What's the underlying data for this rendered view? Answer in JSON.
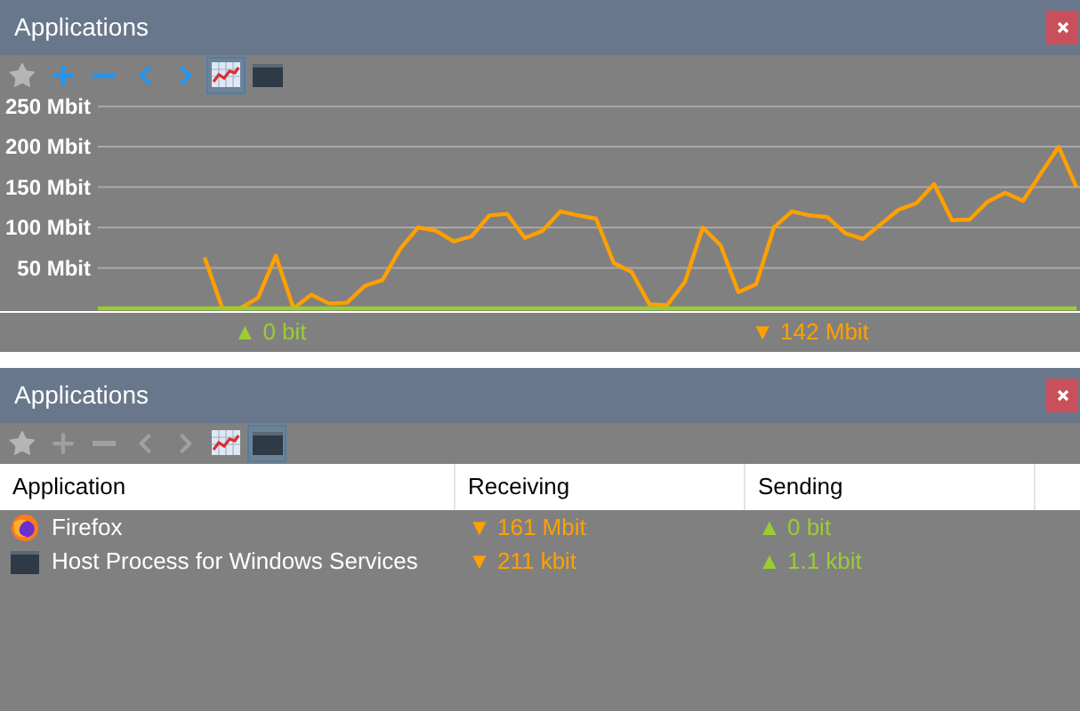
{
  "graph_panel": {
    "title": "Applications",
    "toolbar": [
      {
        "kind": "star",
        "disabled": true,
        "selected": false
      },
      {
        "kind": "add",
        "disabled": false,
        "selected": false
      },
      {
        "kind": "remove",
        "disabled": false,
        "selected": false
      },
      {
        "kind": "back",
        "disabled": false,
        "selected": false
      },
      {
        "kind": "forward",
        "disabled": false,
        "selected": false
      },
      {
        "kind": "graph",
        "selected": true
      },
      {
        "kind": "table",
        "selected": false
      }
    ],
    "chart_data": {
      "type": "line",
      "categories": [
        null,
        null,
        null,
        null,
        null,
        null,
        null,
        null,
        null,
        null,
        null,
        null,
        null,
        null,
        null,
        null,
        null,
        null,
        null,
        null,
        null,
        null,
        null,
        null,
        null,
        null,
        null,
        null,
        null,
        null,
        null,
        null,
        null,
        null,
        null,
        null,
        null,
        null,
        null,
        null,
        null,
        null,
        null,
        null,
        null,
        null,
        null,
        null,
        null,
        null,
        null,
        null,
        null,
        null,
        null,
        null
      ],
      "ylim": [
        0,
        265
      ],
      "grid": true,
      "yticks": [
        {
          "value": 50,
          "label": "50 Mbit"
        },
        {
          "value": 100,
          "label": "100 Mbit"
        },
        {
          "value": 150,
          "label": "150 Mbit"
        },
        {
          "value": 200,
          "label": "200 Mbit"
        },
        {
          "value": 250,
          "label": "250 Mbit"
        }
      ],
      "series": [
        {
          "color": "#ffa000",
          "values": [
            null,
            null,
            null,
            null,
            null,
            null,
            63,
            0,
            0,
            13,
            65,
            0,
            17,
            6,
            7,
            28,
            35,
            74,
            100,
            96,
            83,
            89,
            115,
            117,
            87,
            96,
            120,
            115,
            111,
            56,
            45,
            5,
            4,
            33,
            100,
            78,
            20,
            30,
            100,
            120,
            115,
            113,
            93,
            86,
            104,
            122,
            130,
            154,
            109,
            110,
            132,
            143,
            133,
            167,
            200,
            150
          ]
        },
        {
          "color": "#9acd32",
          "values": [
            0,
            0,
            0,
            0,
            0,
            0,
            0,
            0,
            0,
            0,
            0,
            0,
            0,
            0,
            0,
            0,
            0,
            0,
            0,
            0,
            0,
            0,
            0,
            0,
            0,
            0,
            0,
            0,
            0,
            0,
            0,
            0,
            0,
            0,
            0,
            0,
            0,
            0,
            0,
            0,
            0,
            0,
            0,
            0,
            0,
            0,
            0,
            0,
            0,
            0,
            0,
            0,
            0,
            0,
            0,
            0
          ]
        }
      ]
    },
    "totals": [
      {
        "kind": "up",
        "text": "▲ 0 bit"
      },
      {
        "kind": "down",
        "text": "▼ 142 Mbit"
      }
    ]
  },
  "table_panel": {
    "title": "Applications",
    "toolbar": [
      {
        "kind": "star",
        "disabled": true,
        "selected": false
      },
      {
        "kind": "add",
        "disabled": true,
        "selected": false
      },
      {
        "kind": "remove",
        "disabled": true,
        "selected": false
      },
      {
        "kind": "back",
        "disabled": true,
        "selected": false
      },
      {
        "kind": "forward",
        "disabled": true,
        "selected": false
      },
      {
        "kind": "graph",
        "selected": false
      },
      {
        "kind": "table",
        "selected": true
      }
    ],
    "columns": [
      "Application",
      "Receiving",
      "Sending"
    ],
    "rows": [
      {
        "kind": "firefox",
        "name": "Firefox",
        "receiving": "▼ 161 Mbit",
        "sending": "▲ 0 bit"
      },
      {
        "kind": "window",
        "name": "Host Process for Windows Services",
        "receiving": "▼ 211 kbit",
        "sending": "▲ 1.1 kbit"
      }
    ]
  }
}
